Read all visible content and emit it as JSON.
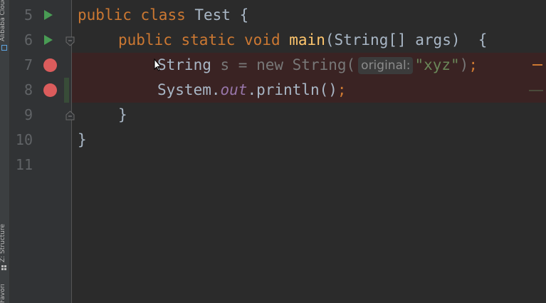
{
  "side_tabs": {
    "top": "Alibaba Cloud",
    "middle": "Z: Structure",
    "bottom": "Favorites"
  },
  "colors": {
    "editor_bg": "#2b2b2b",
    "keyword": "#cc7832",
    "method": "#ffc66d",
    "string": "#6a8759",
    "breakpoint": "#db5c5c",
    "run": "#499c54"
  },
  "lines": [
    {
      "number": "5",
      "gutter": "run-icon"
    },
    {
      "number": "6",
      "gutter": "run-icon"
    },
    {
      "number": "7",
      "gutter": "breakpoint-icon"
    },
    {
      "number": "8",
      "gutter": "breakpoint-icon"
    },
    {
      "number": "9",
      "gutter": ""
    },
    {
      "number": "10",
      "gutter": ""
    },
    {
      "number": "11",
      "gutter": ""
    }
  ],
  "code": {
    "l5": {
      "public": "public",
      "class": "class",
      "name": " Test {"
    },
    "l6": {
      "public": "public",
      "static": "static",
      "void": "void",
      "main": "main",
      "rest": "(String[] args)  {"
    },
    "l7": {
      "type": "String",
      "var": "s = new String(",
      "hint": "original:",
      "str": "\"xyz\"",
      "semi": ";"
    },
    "l8": {
      "sys": "System.",
      "out": "out",
      "call": ".println()",
      "semi": ";"
    },
    "l9": "}",
    "l10": "}"
  }
}
